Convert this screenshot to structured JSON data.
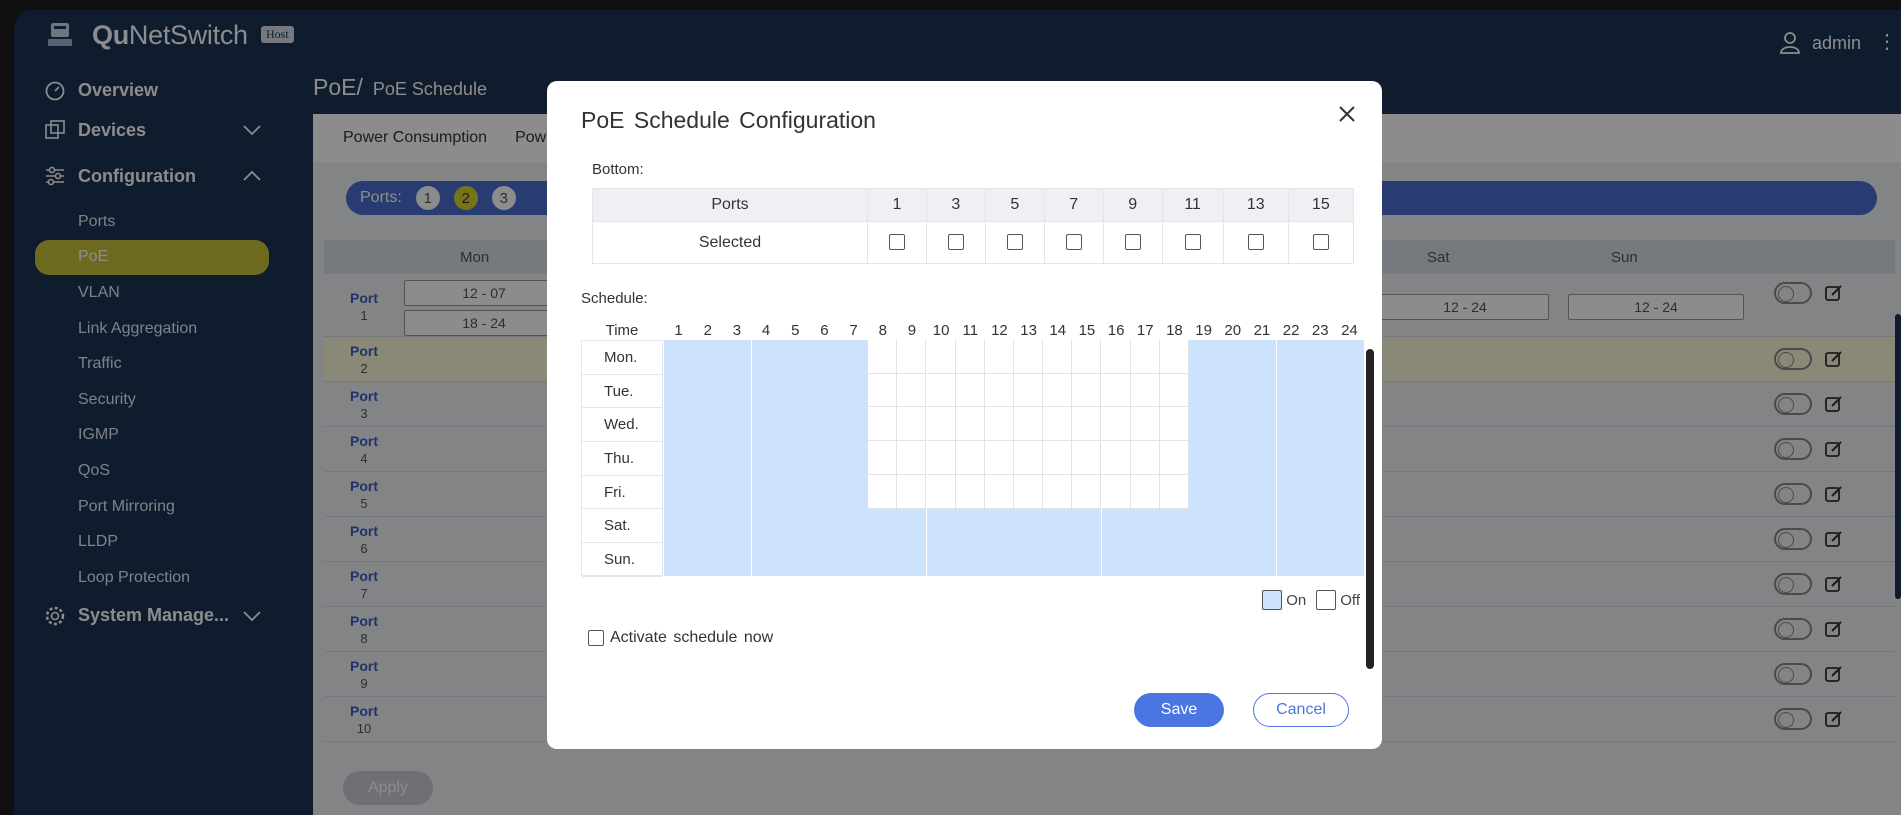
{
  "app": {
    "brand_bold": "Qu",
    "brand_rest": "NetSwitch",
    "host_badge": "Host",
    "user": "admin"
  },
  "sidebar": {
    "overview": "Overview",
    "devices": "Devices",
    "configuration": "Configuration",
    "items": [
      "Ports",
      "PoE",
      "VLAN",
      "Link Aggregation",
      "Traffic",
      "Security",
      "IGMP",
      "QoS",
      "Port Mirroring",
      "LLDP",
      "Loop Protection"
    ],
    "active_item": "PoE",
    "system": "System Manage..."
  },
  "breadcrumb": {
    "root": "PoE/",
    "current": "PoE Schedule"
  },
  "tabs": [
    "Power Consumption",
    "Pow"
  ],
  "portbar": {
    "label": "Ports:",
    "numbers": [
      "1",
      "2",
      "3"
    ],
    "selected": "2"
  },
  "table": {
    "days": [
      "Mon",
      "Sat",
      "Sun"
    ],
    "port_label": "Port",
    "rows": [
      {
        "num": "1",
        "mon": [
          "12 - 07",
          "18 - 24"
        ],
        "sat": "12 - 24",
        "sun": "12 - 24"
      },
      {
        "num": "2"
      },
      {
        "num": "3"
      },
      {
        "num": "4"
      },
      {
        "num": "5"
      },
      {
        "num": "6"
      },
      {
        "num": "7"
      },
      {
        "num": "8"
      },
      {
        "num": "9"
      },
      {
        "num": "10"
      }
    ],
    "apply": "Apply"
  },
  "modal": {
    "title": "PoE Schedule Configuration",
    "bottom_label": "Bottom:",
    "ports_header": "Ports",
    "selected_label": "Selected",
    "port_numbers": [
      "1",
      "3",
      "5",
      "7",
      "9",
      "11",
      "13",
      "15"
    ],
    "schedule_label": "Schedule:",
    "time_label": "Time",
    "hours": [
      "1",
      "2",
      "3",
      "4",
      "5",
      "6",
      "7",
      "8",
      "9",
      "10",
      "11",
      "12",
      "13",
      "14",
      "15",
      "16",
      "17",
      "18",
      "19",
      "20",
      "21",
      "22",
      "23",
      "24"
    ],
    "days": [
      "Mon.",
      "Tue.",
      "Wed.",
      "Thu.",
      "Fri.",
      "Sat.",
      "Sun."
    ],
    "schedule": [
      [
        1,
        1,
        1,
        1,
        1,
        1,
        1,
        0,
        0,
        0,
        0,
        0,
        0,
        0,
        0,
        0,
        0,
        0,
        1,
        1,
        1,
        1,
        1,
        1
      ],
      [
        1,
        1,
        1,
        1,
        1,
        1,
        1,
        0,
        0,
        0,
        0,
        0,
        0,
        0,
        0,
        0,
        0,
        0,
        1,
        1,
        1,
        1,
        1,
        1
      ],
      [
        1,
        1,
        1,
        1,
        1,
        1,
        1,
        0,
        0,
        0,
        0,
        0,
        0,
        0,
        0,
        0,
        0,
        0,
        1,
        1,
        1,
        1,
        1,
        1
      ],
      [
        1,
        1,
        1,
        1,
        1,
        1,
        1,
        0,
        0,
        0,
        0,
        0,
        0,
        0,
        0,
        0,
        0,
        0,
        1,
        1,
        1,
        1,
        1,
        1
      ],
      [
        1,
        1,
        1,
        1,
        1,
        1,
        1,
        0,
        0,
        0,
        0,
        0,
        0,
        0,
        0,
        0,
        0,
        0,
        1,
        1,
        1,
        1,
        1,
        1
      ],
      [
        1,
        1,
        1,
        1,
        1,
        1,
        1,
        1,
        1,
        1,
        1,
        1,
        1,
        1,
        1,
        1,
        1,
        1,
        1,
        1,
        1,
        1,
        1,
        1
      ],
      [
        1,
        1,
        1,
        1,
        1,
        1,
        1,
        1,
        1,
        1,
        1,
        1,
        1,
        1,
        1,
        1,
        1,
        1,
        1,
        1,
        1,
        1,
        1,
        1
      ]
    ],
    "legend_on": "On",
    "legend_off": "Off",
    "activate_label": "Activate schedule now",
    "save": "Save",
    "cancel": "Cancel"
  }
}
